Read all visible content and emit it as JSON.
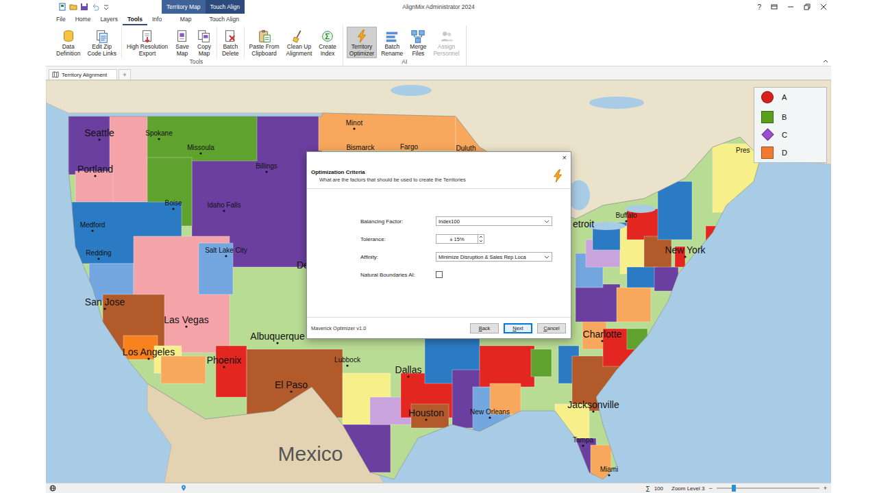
{
  "window": {
    "title": "AlignMix Administrator 2024"
  },
  "title_bar": {
    "contextual_tabs": [
      {
        "label": "Territory Map",
        "selected": true
      },
      {
        "label": "Touch Align",
        "selected": false
      }
    ],
    "help": "?"
  },
  "menu_tabs": [
    {
      "label": "File",
      "selected": false,
      "kind": "main"
    },
    {
      "label": "Home",
      "selected": false,
      "kind": "main"
    },
    {
      "label": "Layers",
      "selected": false,
      "kind": "main"
    },
    {
      "label": "Tools",
      "selected": true,
      "kind": "main"
    },
    {
      "label": "Info",
      "selected": false,
      "kind": "main"
    },
    {
      "label": "Map",
      "selected": false,
      "kind": "contextual"
    },
    {
      "label": "Touch Align",
      "selected": false,
      "kind": "contextual"
    }
  ],
  "ribbon": {
    "groups": [
      {
        "label": "Tools",
        "clusters": [
          [
            {
              "lines": [
                "Data",
                "Definition"
              ],
              "selected": false,
              "disabled": false
            },
            {
              "lines": [
                "Edit Zip",
                "Code Links"
              ],
              "selected": false,
              "disabled": false
            }
          ],
          [
            {
              "lines": [
                "High Resolution",
                "Export"
              ],
              "selected": false,
              "disabled": false
            },
            {
              "lines": [
                "Save",
                "Map"
              ],
              "selected": false,
              "disabled": false
            },
            {
              "lines": [
                "Copy",
                "Map"
              ],
              "selected": false,
              "disabled": false
            }
          ],
          [
            {
              "lines": [
                "Batch",
                "Delete"
              ],
              "selected": false,
              "disabled": false
            }
          ],
          [
            {
              "lines": [
                "Paste From",
                "Clipboard"
              ],
              "selected": false,
              "disabled": false
            },
            {
              "lines": [
                "Clean Up",
                "Alignment"
              ],
              "selected": false,
              "disabled": false
            },
            {
              "lines": [
                "Create",
                "Index"
              ],
              "selected": false,
              "disabled": false
            }
          ]
        ]
      },
      {
        "label": "AI",
        "clusters": [
          [
            {
              "lines": [
                "Territory",
                "Optimizer"
              ],
              "selected": true,
              "disabled": false
            },
            {
              "lines": [
                "Batch",
                "Rename"
              ],
              "selected": false,
              "disabled": false
            },
            {
              "lines": [
                "Merge",
                "Files"
              ],
              "selected": false,
              "disabled": false
            },
            {
              "lines": [
                "Assign",
                "Personnel"
              ],
              "selected": false,
              "disabled": true
            }
          ]
        ]
      }
    ]
  },
  "document_tabs": [
    {
      "label": "Territory Alignment",
      "selected": true
    }
  ],
  "map": {
    "territories": [
      {
        "color": "#6b3fa0"
      },
      {
        "color": "#6b3fa0"
      },
      {
        "color": "#f4a3a8"
      },
      {
        "color": "#5fa32e"
      },
      {
        "color": "#5fa32e"
      },
      {
        "color": "#f8a85c"
      },
      {
        "color": "#f4a3a8"
      },
      {
        "color": "#2b7bc4"
      },
      {
        "color": "#74a6e0"
      },
      {
        "color": "#f4a3a8"
      },
      {
        "color": "#74a6e0"
      },
      {
        "color": "#b35a2a"
      },
      {
        "color": "#f7821e"
      },
      {
        "color": "#f7ef8a"
      },
      {
        "color": "#f8a85c"
      },
      {
        "color": "#e3261f"
      },
      {
        "color": "#b35a2a"
      },
      {
        "color": "#f7ef8a"
      },
      {
        "color": "#6b3fa0"
      },
      {
        "color": "#c9a3dc"
      },
      {
        "color": "#e3261f"
      },
      {
        "color": "#b35a2a"
      },
      {
        "color": "#2b7bc4"
      },
      {
        "color": "#6b3fa0"
      },
      {
        "color": "#74a6e0"
      },
      {
        "color": "#e3261f"
      },
      {
        "color": "#f8a85c"
      },
      {
        "color": "#5fa32e"
      },
      {
        "color": "#2b7bc4"
      },
      {
        "color": "#b35a2a"
      },
      {
        "color": "#f7ef8a"
      },
      {
        "color": "#6b3fa0"
      },
      {
        "color": "#f8a85c"
      },
      {
        "color": "#f8a85c"
      },
      {
        "color": "#6b3fa0"
      },
      {
        "color": "#e3261f"
      },
      {
        "color": "#5fa32e"
      },
      {
        "color": "#f8a85c"
      },
      {
        "color": "#74a6e0"
      },
      {
        "color": "#c9a3dc"
      },
      {
        "color": "#2b7bc4"
      },
      {
        "color": "#f7ef8a"
      },
      {
        "color": "#e3261f"
      },
      {
        "color": "#b35a2a"
      },
      {
        "color": "#2b7bc4"
      },
      {
        "color": "#6b3fa0"
      },
      {
        "color": "#e3261f"
      },
      {
        "color": "#2b7bc4"
      },
      {
        "color": "#f7ef8a"
      },
      {
        "color": "#e3261f"
      },
      {
        "color": "#f8a85c"
      }
    ],
    "cities": [
      {
        "name": "Seattle",
        "kind": "major"
      },
      {
        "name": "Spokane",
        "kind": "minor"
      },
      {
        "name": "Missoula",
        "kind": "minor"
      },
      {
        "name": "Minot",
        "kind": "minor"
      },
      {
        "name": "Bismarck",
        "kind": "minor"
      },
      {
        "name": "Fargo",
        "kind": "minor"
      },
      {
        "name": "Duluth",
        "kind": "minor"
      },
      {
        "name": "Billings",
        "kind": "minor"
      },
      {
        "name": "Portland",
        "kind": "major"
      },
      {
        "name": "Boise",
        "kind": "minor"
      },
      {
        "name": "Idaho Falls",
        "kind": "minor"
      },
      {
        "name": "Medford",
        "kind": "minor"
      },
      {
        "name": "Salt Lake City",
        "kind": "minor"
      },
      {
        "name": "Redding",
        "kind": "minor"
      },
      {
        "name": "De",
        "kind": "major"
      },
      {
        "name": "etroit",
        "kind": "major"
      },
      {
        "name": "Buffalo",
        "kind": "minor"
      },
      {
        "name": "New York",
        "kind": "major"
      },
      {
        "name": "San Jose",
        "kind": "major"
      },
      {
        "name": "Las Vegas",
        "kind": "major"
      },
      {
        "name": "Albuquerque",
        "kind": "major"
      },
      {
        "name": "Los Angeles",
        "kind": "major"
      },
      {
        "name": "Phoenix",
        "kind": "major"
      },
      {
        "name": "El Paso",
        "kind": "major"
      },
      {
        "name": "Lubbock",
        "kind": "minor"
      },
      {
        "name": "Dallas",
        "kind": "major"
      },
      {
        "name": "Charlotte",
        "kind": "major"
      },
      {
        "name": "Houston",
        "kind": "major"
      },
      {
        "name": "New Orleans",
        "kind": "minor"
      },
      {
        "name": "Jacksonville",
        "kind": "major"
      },
      {
        "name": "Tampa",
        "kind": "minor"
      },
      {
        "name": "Miami",
        "kind": "minor"
      },
      {
        "name": "Pres",
        "kind": "minor"
      }
    ],
    "country_label": "Mexico"
  },
  "legend": [
    {
      "label": "A",
      "color": "#d8201c",
      "kind": "circle"
    },
    {
      "label": "B",
      "color": "#5a9e1e",
      "kind": "square"
    },
    {
      "label": "C",
      "color": "#9b4fd0",
      "kind": "diamond"
    },
    {
      "label": "D",
      "color": "#f07a30",
      "kind": "square"
    }
  ],
  "dialog": {
    "close": "×",
    "title": "Optimization Criteria",
    "subtitle": "What are the factors that should be used to create the Territories",
    "fields": [
      {
        "label": "Balancing Factor:",
        "kind": "dropdown",
        "value": "Index100"
      },
      {
        "label": "Tolerance:",
        "kind": "spinner",
        "value": "± 15%"
      },
      {
        "label": "Affinity:",
        "kind": "dropdown",
        "value": "Minimize Disruption & Sales Rep Loca"
      },
      {
        "label": "Natural Boundaries AI:",
        "kind": "checkbox",
        "checked": false
      }
    ],
    "footer_text": "Maverick Optimizer v1.0",
    "buttons": [
      {
        "label": "Back",
        "selected": false
      },
      {
        "label": "Next",
        "selected": true
      },
      {
        "label": "Cancel",
        "selected": false
      }
    ]
  },
  "status_bar": {
    "sum": "∑",
    "count": "100",
    "zoom": "Zoom Level 3",
    "minus": "−",
    "plus": "+",
    "zoom_level": 0.17
  }
}
